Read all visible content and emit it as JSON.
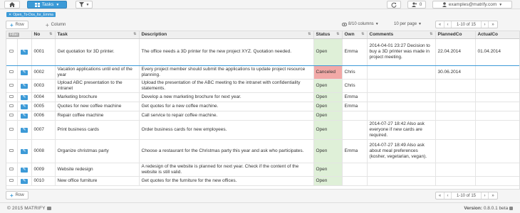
{
  "header": {
    "tasks_label": "Tasks",
    "user_count": "0",
    "user_email": "examples@matrify.com"
  },
  "filter_chip": {
    "label": "Open_To-Dos_for_Emma"
  },
  "toolbar": {
    "add_row_label": "Row",
    "add_column_label": "Column",
    "columns_info": "8/10 columns",
    "per_page": "10 per page",
    "page_range": "1-10 of 15"
  },
  "table": {
    "columns": [
      "No",
      "Task",
      "Description",
      "Status",
      "Own",
      "Comments",
      "PlannedCo",
      "ActualCo"
    ],
    "filter_badge": "Filter",
    "rows": [
      {
        "no": "0001",
        "task": "Get quotation for 3D printer.",
        "description": "The office needs a 3D printer for the new project XYZ. Quotation needed.",
        "status": "Open",
        "owner": "Emma",
        "comments": "2014-04-01 23:27 Decision to buy a 3D printer was made in project meeting.",
        "planned": "22.04.2014",
        "actual": "01.04.2014"
      },
      {
        "no": "0002",
        "task": "Vacation applications until end of the year",
        "description": "Every project member should submit the applications to update project resource planning.",
        "status": "Canceled",
        "owner": "Chris",
        "comments": "",
        "planned": "30.06.2014",
        "actual": ""
      },
      {
        "no": "0003",
        "task": "Upload ABC presentation to the intranet",
        "description": "Upload the presentation of the ABC meeting to the intranet with confidentiality statements.",
        "status": "Open",
        "owner": "Chris",
        "comments": "",
        "planned": "",
        "actual": ""
      },
      {
        "no": "0004",
        "task": "Marketing brochure",
        "description": "Develop a new marketing brochure for next year.",
        "status": "Open",
        "owner": "Emma",
        "comments": "",
        "planned": "",
        "actual": ""
      },
      {
        "no": "0005",
        "task": "Quotes for new coffee machine",
        "description": "Get quotes for a new coffee machine.",
        "status": "Open",
        "owner": "Emma",
        "comments": "",
        "planned": "",
        "actual": ""
      },
      {
        "no": "0006",
        "task": "Repair coffee machine",
        "description": "Call service to repair coffee machine.",
        "status": "Open",
        "owner": "",
        "comments": "",
        "planned": "",
        "actual": ""
      },
      {
        "no": "0007",
        "task": "Print business cards",
        "description": "Order business cards for new employees.",
        "status": "Open",
        "owner": "",
        "comments": "2014-07-27 18:42 Also ask everyone if new cards are required.",
        "planned": "",
        "actual": ""
      },
      {
        "no": "0008",
        "task": "Organize christmas party",
        "description": "Choose a restaurant for the Christmas party this year and ask who participates.",
        "status": "Open",
        "owner": "Emma",
        "comments": "2014-07-27 18:49 Also ask about meal preferences (kosher, vegetarian, vegan).",
        "planned": "",
        "actual": ""
      },
      {
        "no": "0009",
        "task": "Website redesign",
        "description": "A redesign of the website is planned for next year. Check if the content of the website is still valid.",
        "status": "Open",
        "owner": "",
        "comments": "",
        "planned": "",
        "actual": ""
      },
      {
        "no": "0010",
        "task": "New office furniture",
        "description": "Get quotes for the furniture for the new offices.",
        "status": "Open",
        "owner": "",
        "comments": "",
        "planned": "",
        "actual": ""
      }
    ]
  },
  "footer": {
    "copyright": "© 2015 MATRIFY",
    "version_label": "Version:",
    "version_value": "0.8.0.1 beta"
  },
  "colors": {
    "accent": "#3c9ad7",
    "open": "#dff0d8",
    "canceled": "#f2a9a7"
  }
}
